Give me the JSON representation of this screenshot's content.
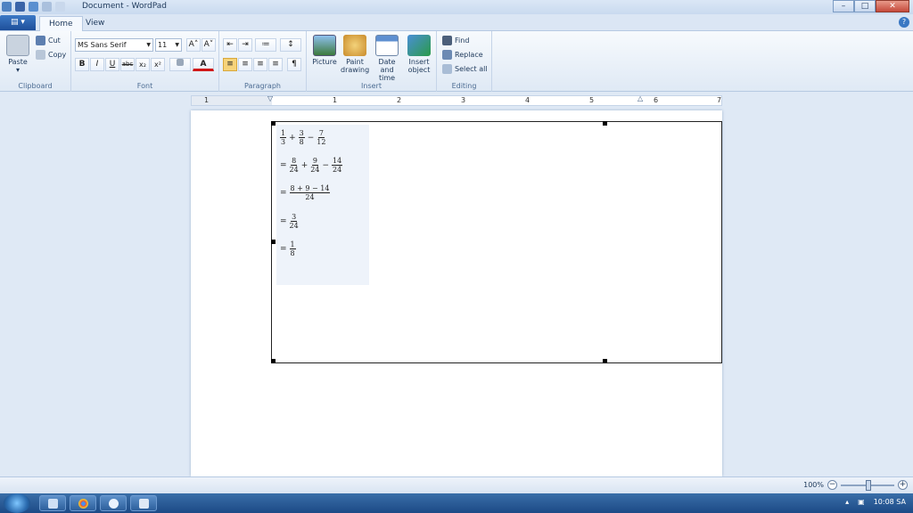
{
  "window": {
    "title": "Document - WordPad",
    "min": "–",
    "max": "□",
    "close": "✕"
  },
  "tabs": {
    "app": "▤ ▾",
    "home": "Home",
    "view": "View",
    "help": "?"
  },
  "clipboard": {
    "paste": "Paste",
    "paste_arrow": "▾",
    "cut": "Cut",
    "copy": "Copy",
    "label": "Clipboard"
  },
  "font": {
    "family": "MS Sans Serif",
    "size": "11",
    "grow": "A˄",
    "shrink": "A˅",
    "bold": "B",
    "italic": "I",
    "underline": "U",
    "strike": "abc",
    "subscript": "x₂",
    "superscript": "x²",
    "label": "Font"
  },
  "paragraph": {
    "label": "Paragraph"
  },
  "insert": {
    "picture": "Picture",
    "paint_drawing_1": "Paint",
    "paint_drawing_2": "drawing",
    "date_time_1": "Date and",
    "date_time_2": "time",
    "insert_object_1": "Insert",
    "insert_object_2": "object",
    "label": "Insert"
  },
  "editing": {
    "find": "Find",
    "replace": "Replace",
    "select_all": "Select all",
    "label": "Editing"
  },
  "ruler": {
    "marks": [
      "1",
      "1",
      "2",
      "3",
      "4",
      "5",
      "6",
      "7"
    ]
  },
  "math": {
    "line1": {
      "f1n": "1",
      "f1d": "3",
      "op1": "+",
      "f2n": "3",
      "f2d": "8",
      "op2": "−",
      "f3n": "7",
      "f3d": "12"
    },
    "line2": {
      "eq": "=",
      "f1n": "8",
      "f1d": "24",
      "op1": "+",
      "f2n": "9",
      "f2d": "24",
      "op2": "−",
      "f3n": "14",
      "f3d": "24"
    },
    "line3": {
      "eq": "=",
      "fn": "8 + 9 − 14",
      "fd": "24"
    },
    "line4": {
      "eq": "=",
      "fn": "3",
      "fd": "24"
    },
    "line5": {
      "eq": "=",
      "fn": "1",
      "fd": "8"
    }
  },
  "status": {
    "zoom": "100%",
    "minus": "−",
    "plus": "+"
  },
  "taskbar": {
    "time": "10:08 SA",
    "tray_arrow": "▴"
  }
}
